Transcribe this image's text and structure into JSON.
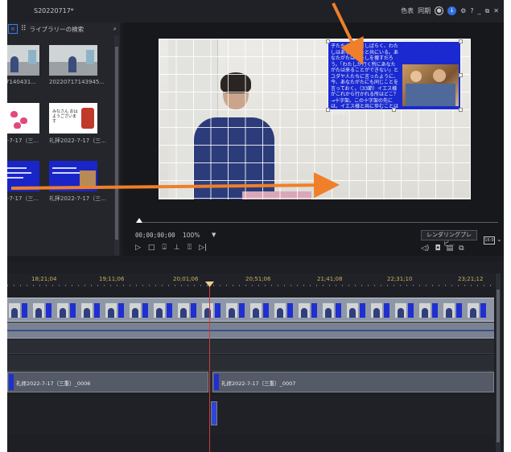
{
  "window": {
    "project_title": "S20220717*",
    "title_icons": [
      "色表",
      "同期"
    ]
  },
  "library": {
    "search_placeholder": "ライブラリーの検索",
    "clips": [
      {
        "caption": "7140431...",
        "kind": "video"
      },
      {
        "caption": "20220717143945...",
        "kind": "video"
      },
      {
        "caption": "-7-17（三...",
        "kind": "slide-hearts"
      },
      {
        "caption": "礼拝2022-7-17（三...",
        "kind": "slide-text"
      },
      {
        "caption": "-7-17（三...",
        "kind": "blue"
      },
      {
        "caption": "礼拝2022-7-17（三...",
        "kind": "blue"
      }
    ],
    "slide_text": "みなさん おはようございます"
  },
  "preview": {
    "overlay_text": "子たちよ、いましばらく、わたしはあなたがたと共にいる。あなたがたはわたしを捜すだろう。「わたしが行く所にあなたがたは来ることができない」とユダヤ人たちに言ったように、今、あなたがたにも同じことを言っておく。（33節）イエス様がこれから行かれる所はどこ？→十字架。この十字架の先には。イエス様と共に歩むことは出来ない",
    "timecode": "00;00;00;00",
    "zoom": "100%",
    "render_button": "レンダリングプレビ...",
    "aspect": "16:9"
  },
  "timeline": {
    "ticks": [
      "18;21;04",
      "19;11;06",
      "20;01;06",
      "20;51;06",
      "21;41;08",
      "22;31;10",
      "23;21;12"
    ],
    "overlay_clips": [
      {
        "label": "礼拝2022-7-17（三重）_0006"
      },
      {
        "label": "礼拝2022-7-17（三重）_0007"
      }
    ]
  },
  "colors": {
    "accent": "#2f6fe0",
    "annotation_arrow": "#f07f2a",
    "playhead": "#d23b3b",
    "overlay_blue": "#1a2ad0"
  }
}
